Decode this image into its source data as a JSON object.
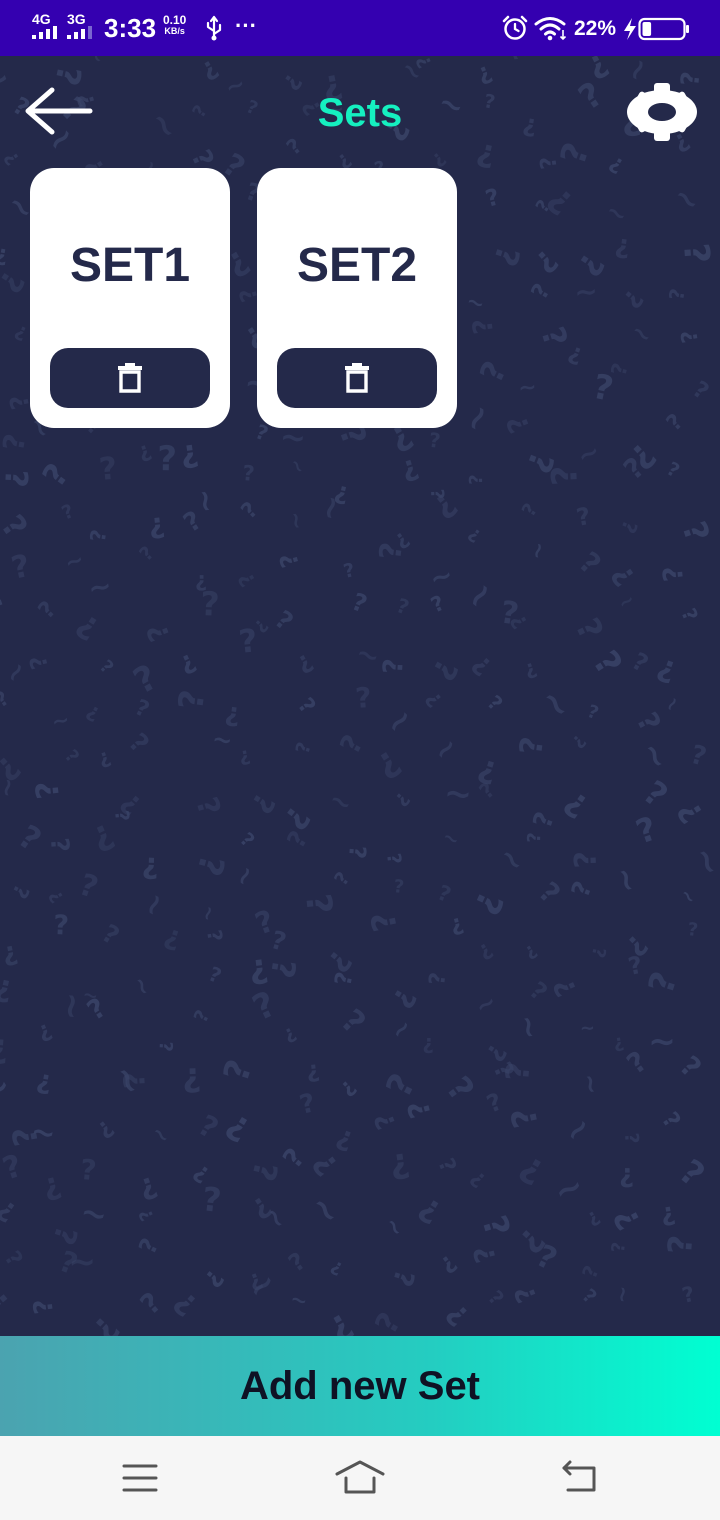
{
  "status_bar": {
    "network_1": "4G",
    "network_2": "3G",
    "time": "3:33",
    "speed_value": "0.10",
    "speed_unit": "KB/s",
    "more": "···",
    "battery_percent": "22%",
    "battery_level": 0.22
  },
  "header": {
    "title": "Sets",
    "back_icon": "arrow-left",
    "settings_icon": "gear"
  },
  "sets": [
    {
      "label": "SET1",
      "delete_icon": "trash"
    },
    {
      "label": "SET2",
      "delete_icon": "trash"
    }
  ],
  "add_button": {
    "label": "Add new Set"
  },
  "nav_bar": {
    "items": [
      "menu",
      "home",
      "back"
    ]
  },
  "colors": {
    "status_bar": "#3400b0",
    "background": "#24294a",
    "accent": "#15f0c0",
    "card": "#ffffff",
    "nav_bar": "#f6f6f6"
  }
}
